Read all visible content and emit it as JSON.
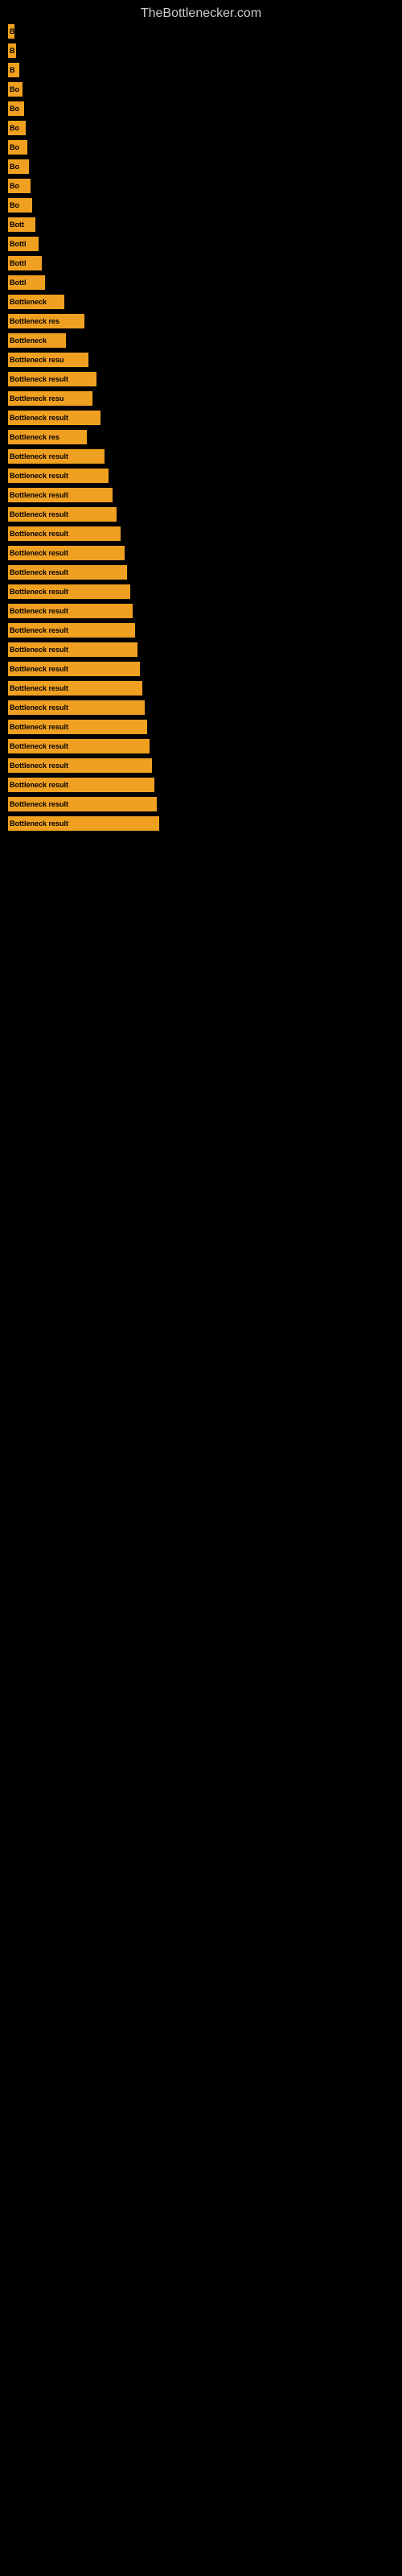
{
  "header": {
    "title": "TheBottlenecker.com"
  },
  "bars": [
    {
      "label": "B",
      "width": 8,
      "gap": 14
    },
    {
      "label": "B",
      "width": 10,
      "gap": 14
    },
    {
      "label": "B",
      "width": 14,
      "gap": 14
    },
    {
      "label": "Bo",
      "width": 18,
      "gap": 14
    },
    {
      "label": "Bo",
      "width": 20,
      "gap": 14
    },
    {
      "label": "Bo",
      "width": 22,
      "gap": 14
    },
    {
      "label": "Bo",
      "width": 24,
      "gap": 14
    },
    {
      "label": "Bo",
      "width": 26,
      "gap": 14
    },
    {
      "label": "Bo",
      "width": 28,
      "gap": 14
    },
    {
      "label": "Bo",
      "width": 30,
      "gap": 14
    },
    {
      "label": "Bott",
      "width": 34,
      "gap": 14
    },
    {
      "label": "Bottl",
      "width": 38,
      "gap": 14
    },
    {
      "label": "Bottl",
      "width": 42,
      "gap": 14
    },
    {
      "label": "Bottl",
      "width": 46,
      "gap": 14
    },
    {
      "label": "Bottleneck",
      "width": 70,
      "gap": 14
    },
    {
      "label": "Bottleneck res",
      "width": 95,
      "gap": 14
    },
    {
      "label": "Bottleneck",
      "width": 72,
      "gap": 14
    },
    {
      "label": "Bottleneck resu",
      "width": 100,
      "gap": 14
    },
    {
      "label": "Bottleneck result",
      "width": 110,
      "gap": 14
    },
    {
      "label": "Bottleneck resu",
      "width": 105,
      "gap": 14
    },
    {
      "label": "Bottleneck result",
      "width": 115,
      "gap": 14
    },
    {
      "label": "Bottleneck res",
      "width": 98,
      "gap": 14
    },
    {
      "label": "Bottleneck result",
      "width": 120,
      "gap": 14
    },
    {
      "label": "Bottleneck result",
      "width": 125,
      "gap": 14
    },
    {
      "label": "Bottleneck result",
      "width": 130,
      "gap": 14
    },
    {
      "label": "Bottleneck result",
      "width": 135,
      "gap": 14
    },
    {
      "label": "Bottleneck result",
      "width": 140,
      "gap": 14
    },
    {
      "label": "Bottleneck result",
      "width": 145,
      "gap": 14
    },
    {
      "label": "Bottleneck result",
      "width": 148,
      "gap": 14
    },
    {
      "label": "Bottleneck result",
      "width": 152,
      "gap": 14
    },
    {
      "label": "Bottleneck result",
      "width": 155,
      "gap": 14
    },
    {
      "label": "Bottleneck result",
      "width": 158,
      "gap": 14
    },
    {
      "label": "Bottleneck result",
      "width": 161,
      "gap": 14
    },
    {
      "label": "Bottleneck result",
      "width": 164,
      "gap": 14
    },
    {
      "label": "Bottleneck result",
      "width": 167,
      "gap": 14
    },
    {
      "label": "Bottleneck result",
      "width": 170,
      "gap": 14
    },
    {
      "label": "Bottleneck result",
      "width": 173,
      "gap": 14
    },
    {
      "label": "Bottleneck result",
      "width": 176,
      "gap": 14
    },
    {
      "label": "Bottleneck result",
      "width": 179,
      "gap": 14
    },
    {
      "label": "Bottleneck result",
      "width": 182,
      "gap": 14
    },
    {
      "label": "Bottleneck result",
      "width": 185,
      "gap": 14
    },
    {
      "label": "Bottleneck result",
      "width": 188,
      "gap": 14
    }
  ]
}
